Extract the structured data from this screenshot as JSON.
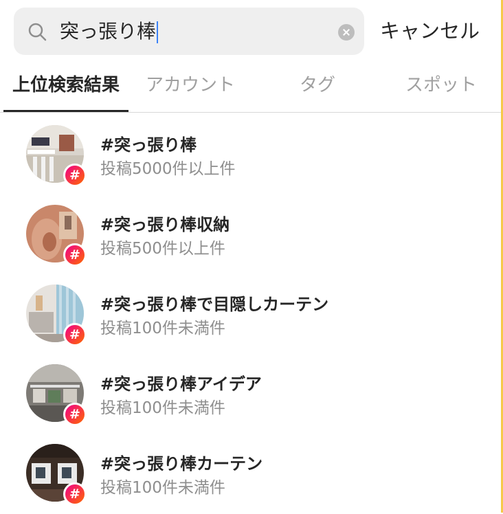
{
  "search": {
    "query": "突っ張り棒",
    "cancel_label": "キャンセル"
  },
  "tabs": [
    {
      "label": "上位検索結果",
      "active": true
    },
    {
      "label": "アカウント",
      "active": false
    },
    {
      "label": "タグ",
      "active": false
    },
    {
      "label": "スポット",
      "active": false
    }
  ],
  "results": [
    {
      "title": "#突っ張り棒",
      "subtitle": "投稿5000件以上件",
      "badge": "#"
    },
    {
      "title": "#突っ張り棒収納",
      "subtitle": "投稿500件以上件",
      "badge": "#"
    },
    {
      "title": "#突っ張り棒で目隠しカーテン",
      "subtitle": "投稿100件未満件",
      "badge": "#"
    },
    {
      "title": "#突っ張り棒アイデア",
      "subtitle": "投稿100件未満件",
      "badge": "#"
    },
    {
      "title": "#突っ張り棒カーテン",
      "subtitle": "投稿100件未満件",
      "badge": "#"
    }
  ],
  "colors": {
    "accent_gradient_start": "#f0008a",
    "accent_gradient_end": "#ff6a00",
    "search_background": "#efefef",
    "inactive_tab": "#a0a0a0"
  },
  "icons": {
    "search": "search-icon",
    "clear": "clear-icon",
    "hashtag_badge": "hashtag-badge-icon"
  }
}
